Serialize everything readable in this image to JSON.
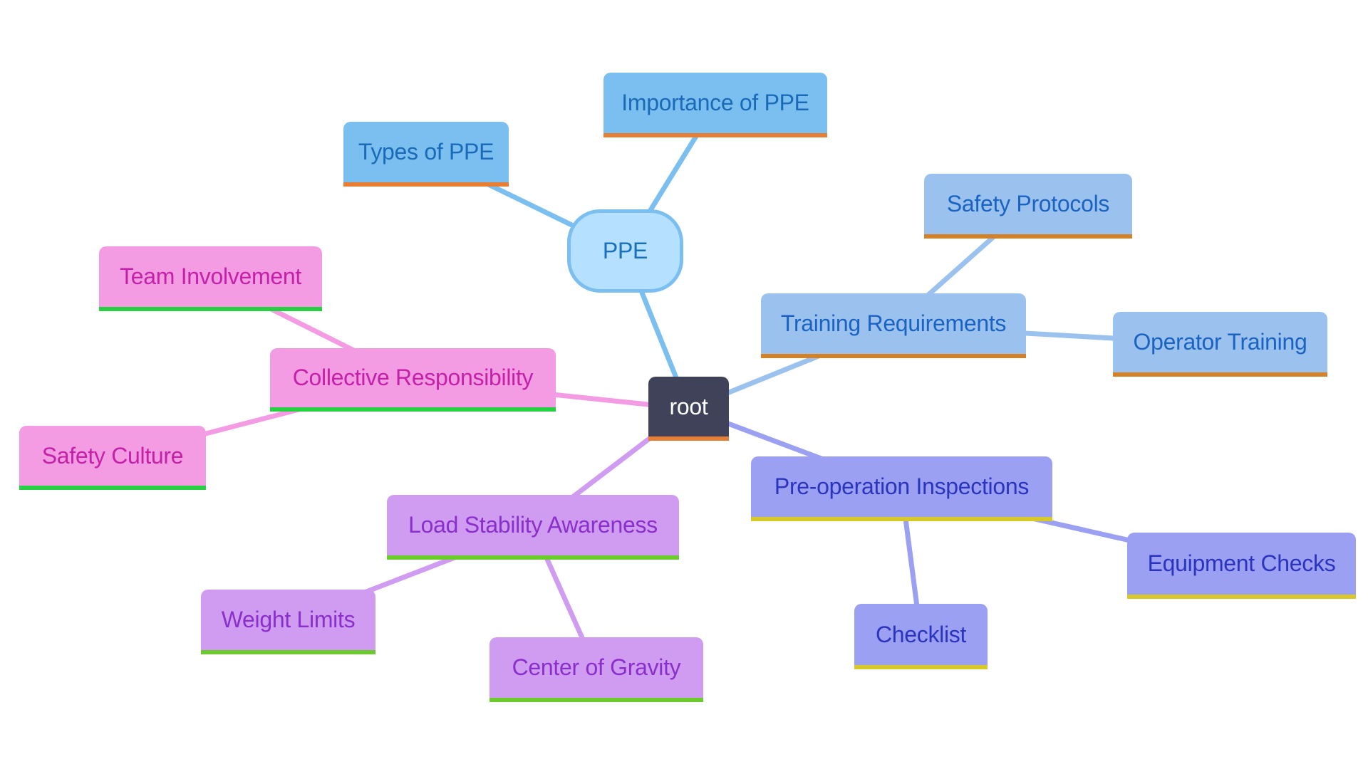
{
  "diagram": {
    "type": "mindmap",
    "nodes": [
      {
        "id": "root",
        "label": "root",
        "shape": "root",
        "bg": "#404259",
        "fg": "#ffffff",
        "bar": "#e67e33"
      },
      {
        "id": "ppe",
        "label": "PPE",
        "parent": "root",
        "shape": "pill",
        "bg": "#b5e0ff",
        "fg": "#1a70b8",
        "border": "#7bbff0",
        "edge": "#7bbff0"
      },
      {
        "id": "types-of-ppe",
        "label": "Types of PPE",
        "parent": "ppe",
        "bg": "#7bbff0",
        "fg": "#1a6ab8",
        "bar": "#e67e33",
        "edge": "#7bbff0"
      },
      {
        "id": "importance-of-ppe",
        "label": "Importance of PPE",
        "parent": "ppe",
        "bg": "#7bbff0",
        "fg": "#1a6ab8",
        "bar": "#e67e33",
        "edge": "#7bbff0"
      },
      {
        "id": "training-requirements",
        "label": "Training Requirements",
        "parent": "root",
        "bg": "#9bc2ef",
        "fg": "#1b63c2",
        "bar": "#d58226",
        "edge": "#9bc2ef"
      },
      {
        "id": "safety-protocols",
        "label": "Safety Protocols",
        "parent": "training-requirements",
        "bg": "#9bc2ef",
        "fg": "#1b63c2",
        "bar": "#d58226",
        "edge": "#9bc2ef"
      },
      {
        "id": "operator-training",
        "label": "Operator Training",
        "parent": "training-requirements",
        "bg": "#9bc2ef",
        "fg": "#1b63c2",
        "bar": "#d58226",
        "edge": "#9bc2ef"
      },
      {
        "id": "pre-operation-inspections",
        "label": "Pre-operation Inspections",
        "parent": "root",
        "bg": "#9ba0f2",
        "fg": "#2b34bf",
        "bar": "#d8c929",
        "edge": "#9ba0f2"
      },
      {
        "id": "equipment-checks",
        "label": "Equipment Checks",
        "parent": "pre-operation-inspections",
        "bg": "#9ba0f2",
        "fg": "#2b34bf",
        "bar": "#d8c929",
        "edge": "#9ba0f2"
      },
      {
        "id": "checklist",
        "label": "Checklist",
        "parent": "pre-operation-inspections",
        "bg": "#9ba0f2",
        "fg": "#2b34bf",
        "bar": "#d8c929",
        "edge": "#9ba0f2"
      },
      {
        "id": "load-stability-awareness",
        "label": "Load Stability Awareness",
        "parent": "root",
        "bg": "#d09cf2",
        "fg": "#8a2fcc",
        "bar": "#6ccb2c",
        "edge": "#d09cf2"
      },
      {
        "id": "weight-limits",
        "label": "Weight Limits",
        "parent": "load-stability-awareness",
        "bg": "#d09cf2",
        "fg": "#8a2fcc",
        "bar": "#6ccb2c",
        "edge": "#d09cf2"
      },
      {
        "id": "center-of-gravity",
        "label": "Center of Gravity",
        "parent": "load-stability-awareness",
        "bg": "#d09cf2",
        "fg": "#8a2fcc",
        "bar": "#6ccb2c",
        "edge": "#d09cf2"
      },
      {
        "id": "collective-responsibility",
        "label": "Collective Responsibility",
        "parent": "root",
        "bg": "#f39be3",
        "fg": "#c420a8",
        "bar": "#27cf43",
        "edge": "#f39be3"
      },
      {
        "id": "team-involvement",
        "label": "Team Involvement",
        "parent": "collective-responsibility",
        "bg": "#f39be3",
        "fg": "#c420a8",
        "bar": "#27cf43",
        "edge": "#f39be3"
      },
      {
        "id": "safety-culture",
        "label": "Safety Culture",
        "parent": "collective-responsibility",
        "bg": "#f39be3",
        "fg": "#c420a8",
        "bar": "#27cf43",
        "edge": "#f39be3"
      }
    ]
  }
}
